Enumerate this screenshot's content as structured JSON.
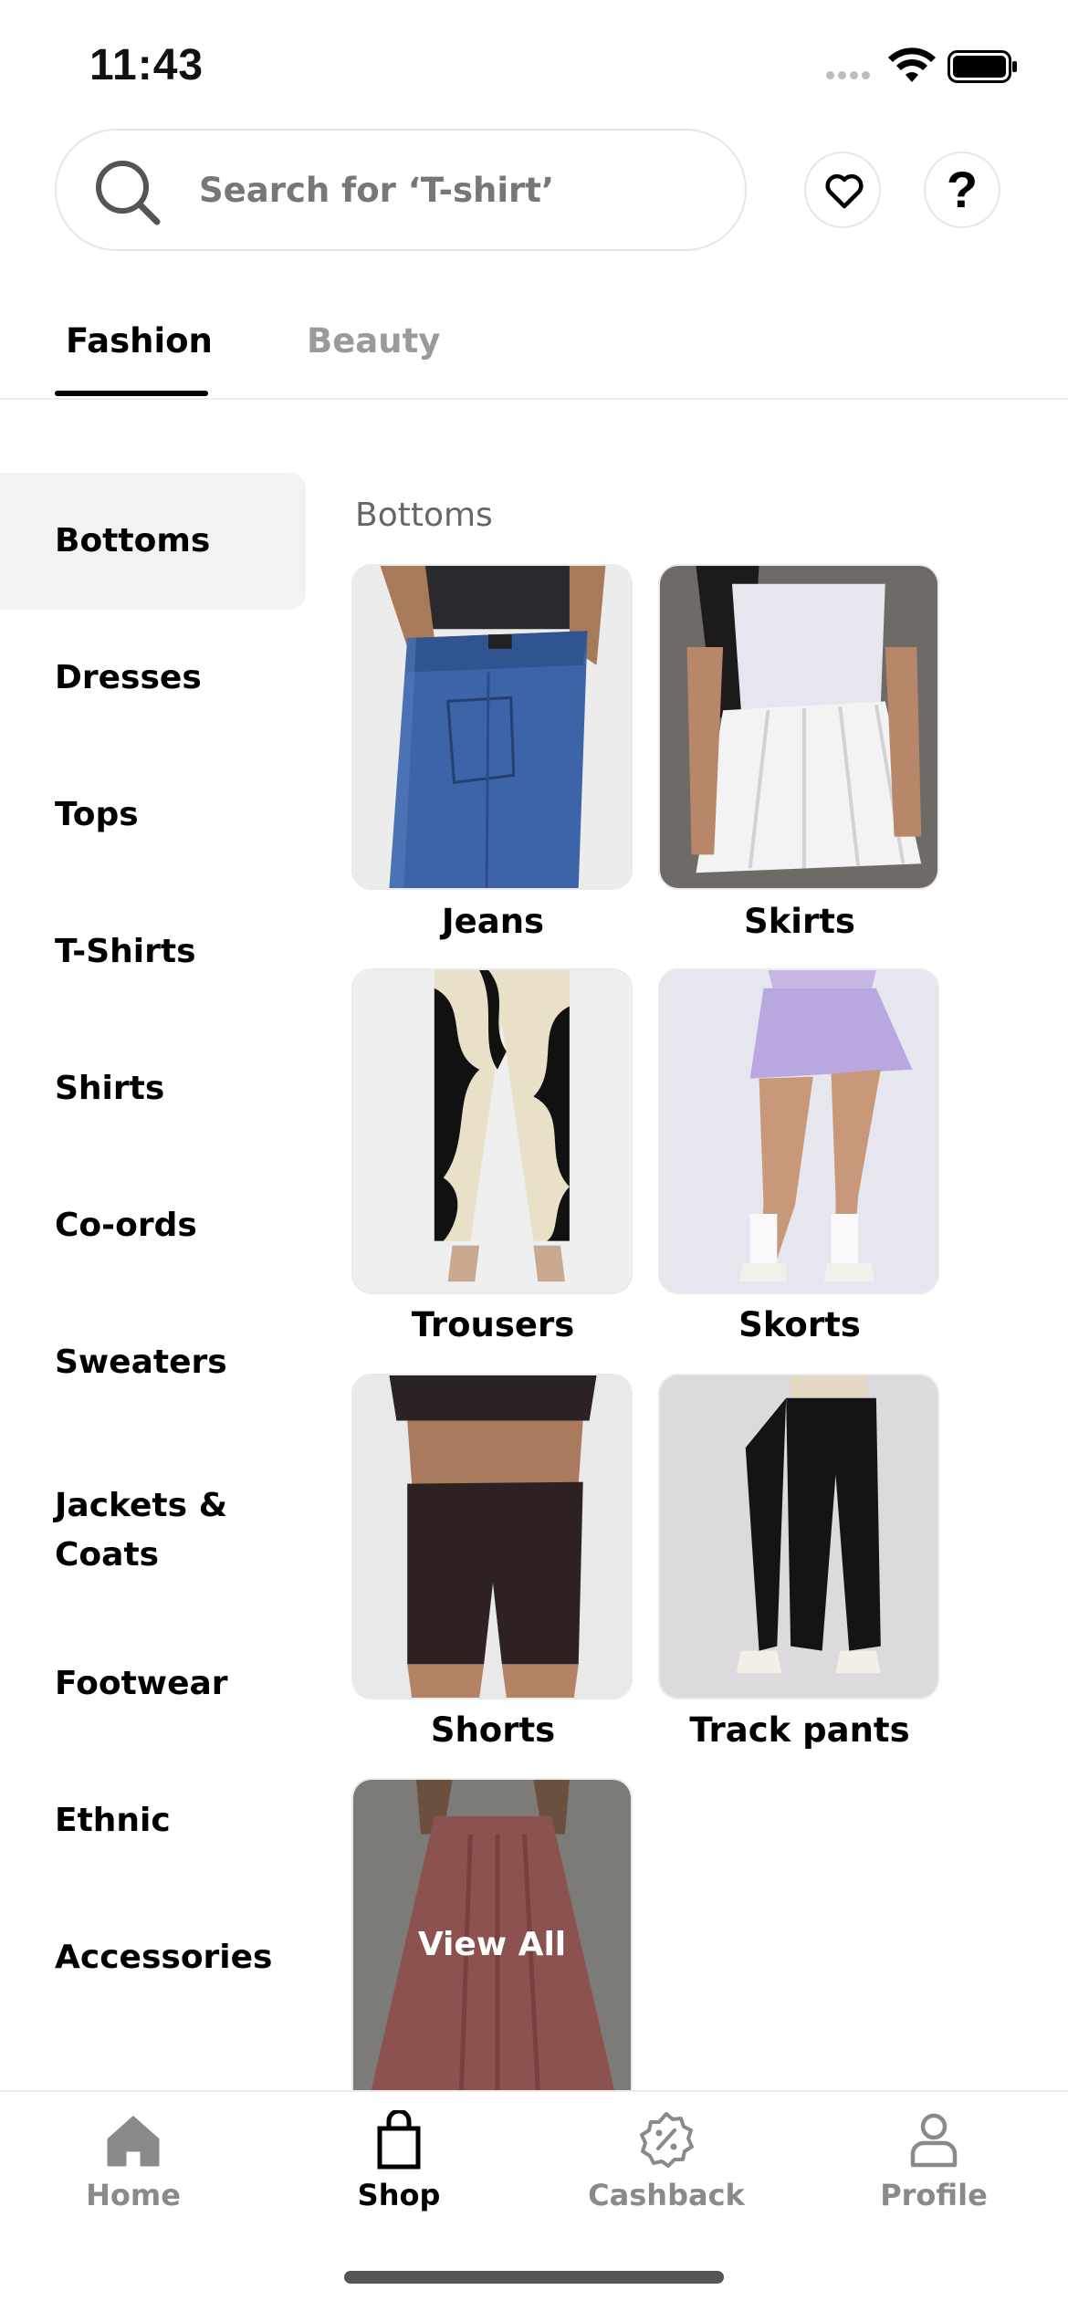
{
  "status_bar": {
    "time": "11:43"
  },
  "search": {
    "placeholder": "Search for ‘T-shirt’"
  },
  "tabs": [
    {
      "label": "Fashion",
      "active": true
    },
    {
      "label": "Beauty",
      "active": false
    }
  ],
  "sidebar": {
    "items": [
      {
        "label": "Bottoms",
        "active": true
      },
      {
        "label": "Dresses"
      },
      {
        "label": "Tops"
      },
      {
        "label": "T-Shirts"
      },
      {
        "label": "Shirts"
      },
      {
        "label": "Co-ords"
      },
      {
        "label": "Sweaters"
      },
      {
        "label": "Jackets &\nCoats"
      },
      {
        "label": "Footwear"
      },
      {
        "label": "Ethnic"
      },
      {
        "label": "Accessories"
      }
    ]
  },
  "content": {
    "heading": "Bottoms",
    "categories": [
      {
        "label": "Jeans",
        "image": "jeans-photo"
      },
      {
        "label": "Skirts",
        "image": "skirt-photo"
      },
      {
        "label": "Trousers",
        "image": "trousers-photo"
      },
      {
        "label": "Skorts",
        "image": "skort-photo"
      },
      {
        "label": "Shorts",
        "image": "shorts-photo"
      },
      {
        "label": "Track pants",
        "image": "trackpants-photo"
      }
    ],
    "view_all": "View All"
  },
  "bottom_nav": {
    "items": [
      {
        "label": "Home",
        "icon": "home-icon",
        "active": false
      },
      {
        "label": "Shop",
        "icon": "shopping-bag-icon",
        "active": true
      },
      {
        "label": "Cashback",
        "icon": "cashback-badge-icon",
        "active": false
      },
      {
        "label": "Profile",
        "icon": "profile-icon",
        "active": false
      }
    ]
  }
}
